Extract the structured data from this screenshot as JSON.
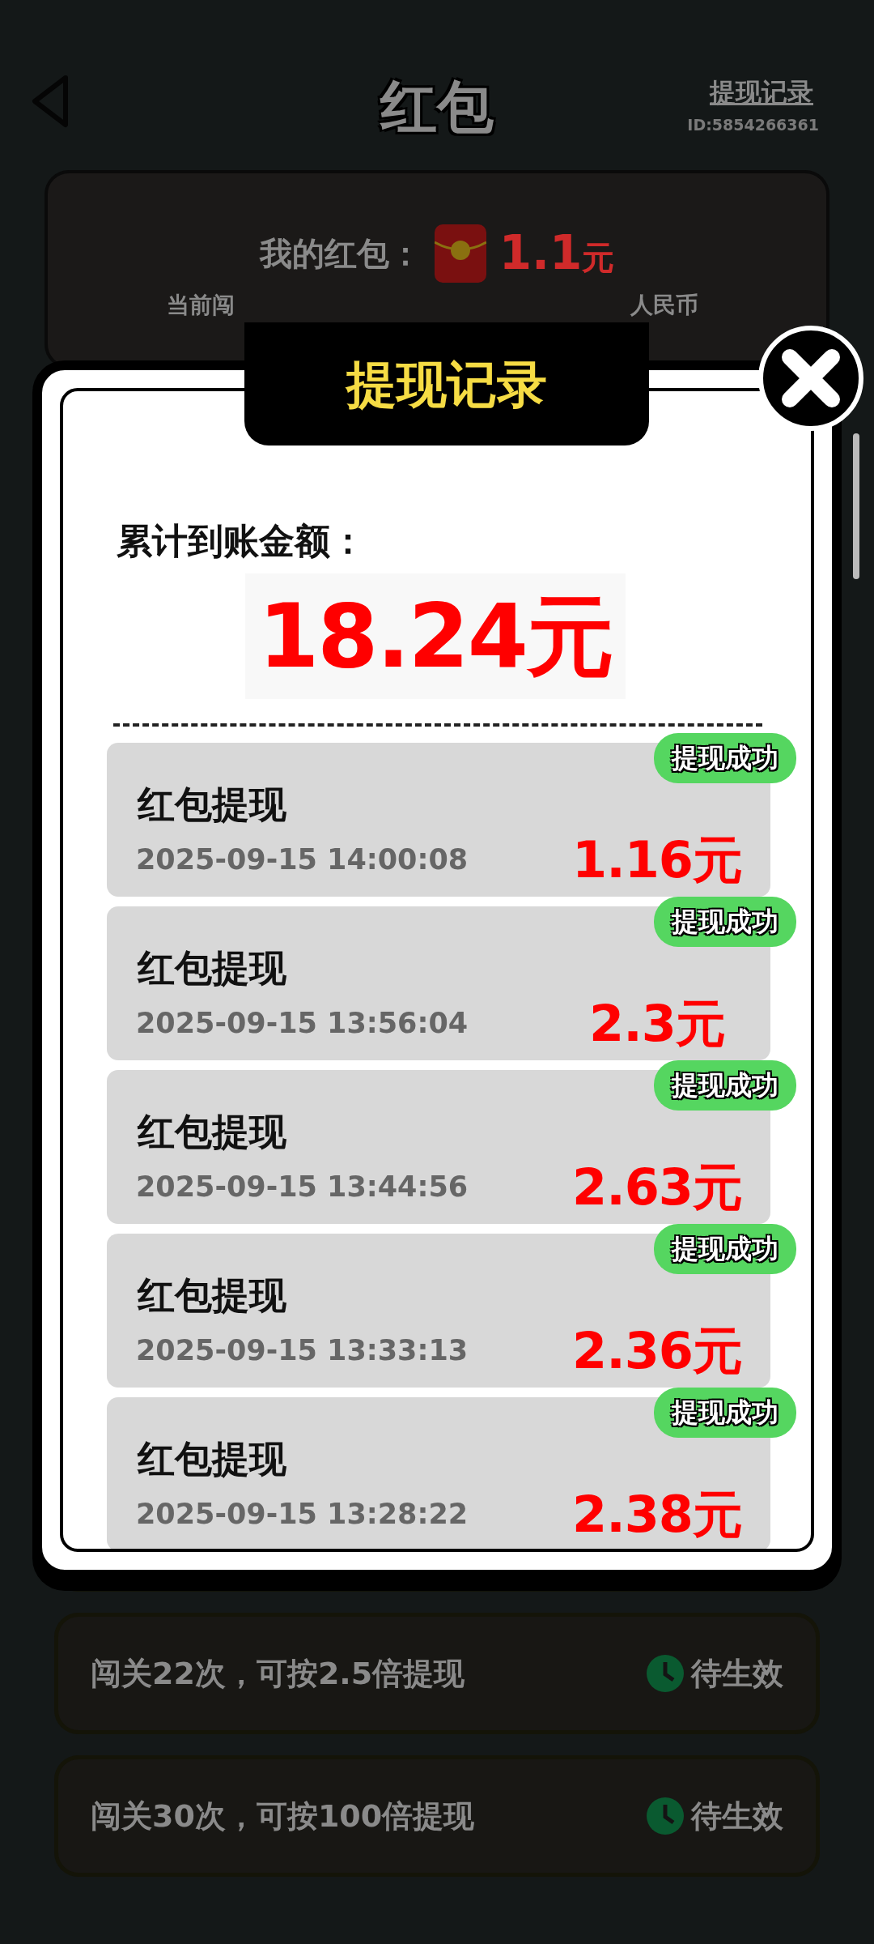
{
  "header": {
    "title": "红包",
    "link": "提现记录",
    "user_id": "ID:5854266361"
  },
  "balance_card": {
    "label": "我的红包：",
    "amount": "1.1",
    "unit": "元",
    "note_parts": [
      "当前闯",
      "人民币"
    ]
  },
  "modal": {
    "title": "提现记录",
    "total_label": "累计到账金额：",
    "total": "18.24元",
    "records": [
      {
        "title": "红包提现",
        "time": "2025-09-15 14:00:08",
        "amount": "1.16元",
        "status": "提现成功"
      },
      {
        "title": "红包提现",
        "time": "2025-09-15 13:56:04",
        "amount": "2.3元",
        "status": "提现成功"
      },
      {
        "title": "红包提现",
        "time": "2025-09-15 13:44:56",
        "amount": "2.63元",
        "status": "提现成功"
      },
      {
        "title": "红包提现",
        "time": "2025-09-15 13:33:13",
        "amount": "2.36元",
        "status": "提现成功"
      },
      {
        "title": "红包提现",
        "time": "2025-09-15 13:28:22",
        "amount": "2.38元",
        "status": "提现成功"
      }
    ]
  },
  "tasks": [
    {
      "text": "闯关22次，可按2.5倍提现",
      "status": "待生效"
    },
    {
      "text": "闯关30次，可按100倍提现",
      "status": "待生效"
    }
  ]
}
